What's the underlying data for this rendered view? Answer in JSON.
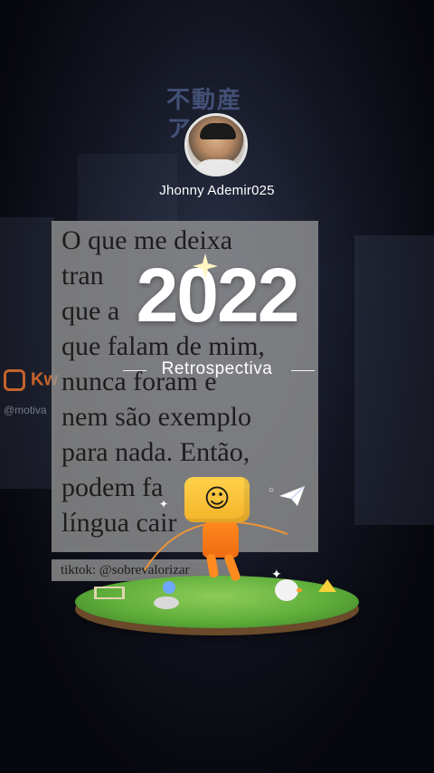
{
  "profile": {
    "username": "Jhonny Ademir025"
  },
  "background": {
    "neon_sign": "不動産\nアク…",
    "kwai_label": "Kw",
    "kwai_handle": "@motiva"
  },
  "quote": {
    "lines": [
      "O que me deixa",
      "tran",
      "que a",
      "que falam de mim,",
      "nunca foram e",
      "nem são exemplo",
      "para nada. Então,",
      "podem fa",
      "língua cair"
    ],
    "tiktok_handle": "tiktok: @sobrevalorizar"
  },
  "overlay": {
    "year": "2022",
    "subtitle": "Retrospectiva"
  },
  "colors": {
    "text_white": "#ffffff",
    "card_gray": "#969696",
    "mascot_yellow": "#ffd24a",
    "mascot_orange": "#ff8b1f",
    "grass_green": "#5fae3a"
  },
  "icons": {
    "sparkle": "sparkle-icon",
    "paper_plane": "paper-plane-icon",
    "mascot": "smiley-box-mascot-icon"
  }
}
